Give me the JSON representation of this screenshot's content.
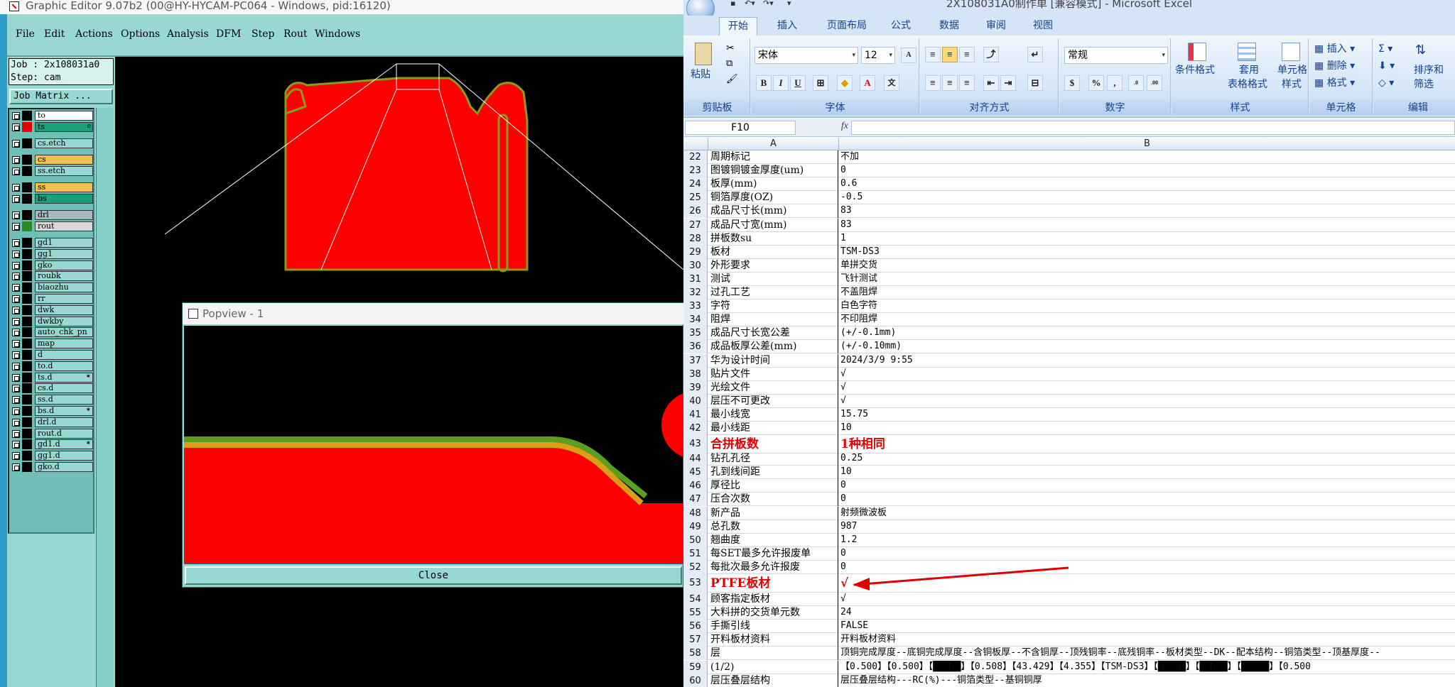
{
  "genesis": {
    "title": "Graphic Editor 9.07b2 (00@HY-HYCAM-PC064 - Windows, pid:16120)",
    "menu": [
      "File",
      "Edit",
      "Actions",
      "Options",
      "Analysis",
      "DFM",
      "Step",
      "Rout",
      "Windows"
    ],
    "job_line": "Job : 2x108031a0",
    "step_line": "Step: cam",
    "job_matrix_label": "Job Matrix ...",
    "layers": [
      {
        "name": "to",
        "color": "#ffffff",
        "swatch": "#000000",
        "mark": ""
      },
      {
        "name": "ts",
        "color": "#1aa07a",
        "swatch": "#e00000",
        "mark": "e"
      },
      {
        "name": "cs.etch",
        "color": "#97d8d2",
        "swatch": "#000000",
        "mark": ""
      },
      {
        "name": "cs",
        "color": "#f0c050",
        "swatch": "#000000",
        "mark": ""
      },
      {
        "name": "ss.etch",
        "color": "#97d8d2",
        "swatch": "#000000",
        "mark": ""
      },
      {
        "name": "ss",
        "color": "#f0c050",
        "swatch": "#000000",
        "mark": ""
      },
      {
        "name": "bs",
        "color": "#1aa07a",
        "swatch": "#000000",
        "mark": ""
      },
      {
        "name": "drl",
        "color": "#a8b8bc",
        "swatch": "#000000",
        "mark": ""
      },
      {
        "name": "rout",
        "color": "#d8d8d8",
        "swatch": "#2a8a2a",
        "mark": ""
      },
      {
        "name": "gd1",
        "color": "#97d8d2",
        "swatch": "#000000",
        "mark": ""
      },
      {
        "name": "gg1",
        "color": "#97d8d2",
        "swatch": "#000000",
        "mark": ""
      },
      {
        "name": "gko",
        "color": "#97d8d2",
        "swatch": "#000000",
        "mark": ""
      },
      {
        "name": "roubk",
        "color": "#97d8d2",
        "swatch": "#000000",
        "mark": ""
      },
      {
        "name": "biaozhu",
        "color": "#97d8d2",
        "swatch": "#000000",
        "mark": ""
      },
      {
        "name": "rr",
        "color": "#97d8d2",
        "swatch": "#000000",
        "mark": ""
      },
      {
        "name": "dwk",
        "color": "#97d8d2",
        "swatch": "#000000",
        "mark": ""
      },
      {
        "name": "dwkby",
        "color": "#97d8d2",
        "swatch": "#000000",
        "mark": ""
      },
      {
        "name": "auto_chk_pn",
        "color": "#97d8d2",
        "swatch": "#000000",
        "mark": ""
      },
      {
        "name": "map",
        "color": "#97d8d2",
        "swatch": "#000000",
        "mark": ""
      },
      {
        "name": "d",
        "color": "#97d8d2",
        "swatch": "#000000",
        "mark": ""
      },
      {
        "name": "to.d",
        "color": "#97d8d2",
        "swatch": "#000000",
        "mark": ""
      },
      {
        "name": "ts.d",
        "color": "#97d8d2",
        "swatch": "#000000",
        "mark": "✶"
      },
      {
        "name": "cs.d",
        "color": "#97d8d2",
        "swatch": "#000000",
        "mark": ""
      },
      {
        "name": "ss.d",
        "color": "#97d8d2",
        "swatch": "#000000",
        "mark": ""
      },
      {
        "name": "bs.d",
        "color": "#97d8d2",
        "swatch": "#000000",
        "mark": "✶"
      },
      {
        "name": "drl.d",
        "color": "#97d8d2",
        "swatch": "#000000",
        "mark": ""
      },
      {
        "name": "rout.d",
        "color": "#97d8d2",
        "swatch": "#000000",
        "mark": ""
      },
      {
        "name": "gd1.d",
        "color": "#97d8d2",
        "swatch": "#000000",
        "mark": "✶"
      },
      {
        "name": "gg1.d",
        "color": "#97d8d2",
        "swatch": "#000000",
        "mark": ""
      },
      {
        "name": "gko.d",
        "color": "#97d8d2",
        "swatch": "#000000",
        "mark": ""
      }
    ],
    "popview": {
      "title": "Popview - 1",
      "close_label": "Close"
    }
  },
  "excel": {
    "title": "2X108031A0制作单 [兼容模式] - Microsoft Excel",
    "tabs": [
      "开始",
      "插入",
      "页面布局",
      "公式",
      "数据",
      "审阅",
      "视图"
    ],
    "ribbon": {
      "paste": "粘贴",
      "clipboard": "剪贴板",
      "font_name": "宋体",
      "font_size": "12",
      "font_group": "字体",
      "align_group": "对齐方式",
      "number_format": "常规",
      "number_group": "数字",
      "cond_format_1": "条件格式",
      "table_format_1": "套用",
      "table_format_2": "表格格式",
      "cell_style_1": "单元格",
      "cell_style_2": "样式",
      "style_group": "样式",
      "insert": "插入",
      "delete": "删除",
      "format": "格式",
      "cells_group": "单元格",
      "sort_1": "排序和",
      "sort_2": "筛选",
      "edit_group": "编辑"
    },
    "name_box": "F10",
    "fx": "fx",
    "columns": [
      "A",
      "B"
    ],
    "rows": [
      {
        "n": "22",
        "a": "周期标记",
        "b": "不加"
      },
      {
        "n": "23",
        "a": "图镀铜镀金厚度(um)",
        "b": "0"
      },
      {
        "n": "24",
        "a": "板厚(mm)",
        "b": "0.6"
      },
      {
        "n": "25",
        "a": "铜箔厚度(OZ)",
        "b": "-0.5"
      },
      {
        "n": "26",
        "a": "成品尺寸长(mm)",
        "b": "83"
      },
      {
        "n": "27",
        "a": "成品尺寸宽(mm)",
        "b": "83"
      },
      {
        "n": "28",
        "a": "拼板数su",
        "b": "1"
      },
      {
        "n": "29",
        "a": "板材",
        "b": "TSM-DS3"
      },
      {
        "n": "30",
        "a": "外形要求",
        "b": "单拼交货"
      },
      {
        "n": "31",
        "a": "测试",
        "b": "飞针测试"
      },
      {
        "n": "32",
        "a": "过孔工艺",
        "b": "不盖阻焊"
      },
      {
        "n": "33",
        "a": "字符",
        "b": "白色字符"
      },
      {
        "n": "34",
        "a": "阻焊",
        "b": "不印阻焊"
      },
      {
        "n": "35",
        "a": "成品尺寸长宽公差",
        "b": "(+/-0.1mm)"
      },
      {
        "n": "36",
        "a": "成品板厚公差(mm)",
        "b": "(+/-0.10mm)"
      },
      {
        "n": "37",
        "a": "华为设计时间",
        "b": "2024/3/9 9:55"
      },
      {
        "n": "38",
        "a": "贴片文件",
        "b": "√"
      },
      {
        "n": "39",
        "a": "光绘文件",
        "b": "√"
      },
      {
        "n": "40",
        "a": "层压不可更改",
        "b": "√"
      },
      {
        "n": "41",
        "a": "最小线宽",
        "b": "15.75"
      },
      {
        "n": "42",
        "a": "最小线距",
        "b": "10"
      },
      {
        "n": "43",
        "a": "合拼板数",
        "b": "1种相同",
        "hl": true
      },
      {
        "n": "44",
        "a": "钻孔孔径",
        "b": "0.25"
      },
      {
        "n": "45",
        "a": "孔到线间距",
        "b": "10"
      },
      {
        "n": "46",
        "a": "厚径比",
        "b": "0"
      },
      {
        "n": "47",
        "a": "压合次数",
        "b": "0"
      },
      {
        "n": "48",
        "a": "新产品",
        "b": "射频微波板"
      },
      {
        "n": "49",
        "a": "总孔数",
        "b": "987"
      },
      {
        "n": "50",
        "a": "翘曲度",
        "b": "1.2"
      },
      {
        "n": "51",
        "a": "每SET最多允许报废单",
        "b": "0"
      },
      {
        "n": "52",
        "a": "每批次最多允许报废",
        "b": "0"
      },
      {
        "n": "53",
        "a": "PTFE板材",
        "b": "√",
        "hl": true
      },
      {
        "n": "54",
        "a": "顾客指定板材",
        "b": "√"
      },
      {
        "n": "55",
        "a": "大料拼的交货单元数",
        "b": "24"
      },
      {
        "n": "56",
        "a": "手撕引线",
        "b": "FALSE"
      },
      {
        "n": "57",
        "a": "开料板材资料",
        "b": "开料板材资料"
      },
      {
        "n": "58",
        "a": "层",
        "b": "顶铜完成厚度--底铜完成厚度--含铜板厚--不含铜厚--顶残铜率--底残铜率--板材类型--DK--配本结构--铜箔类型--顶基厚度--"
      },
      {
        "n": "59",
        "a": "(1/2)",
        "b": "【0.500】【0.500】【█████】【0.508】【43.429】【4.355】【TSM-DS3】【█████】【█████】【█████】【0.500"
      },
      {
        "n": "60",
        "a": "层压叠层结构",
        "b": "层压叠层结构---RC(%)---铜箔类型--基铜铜厚"
      }
    ]
  }
}
